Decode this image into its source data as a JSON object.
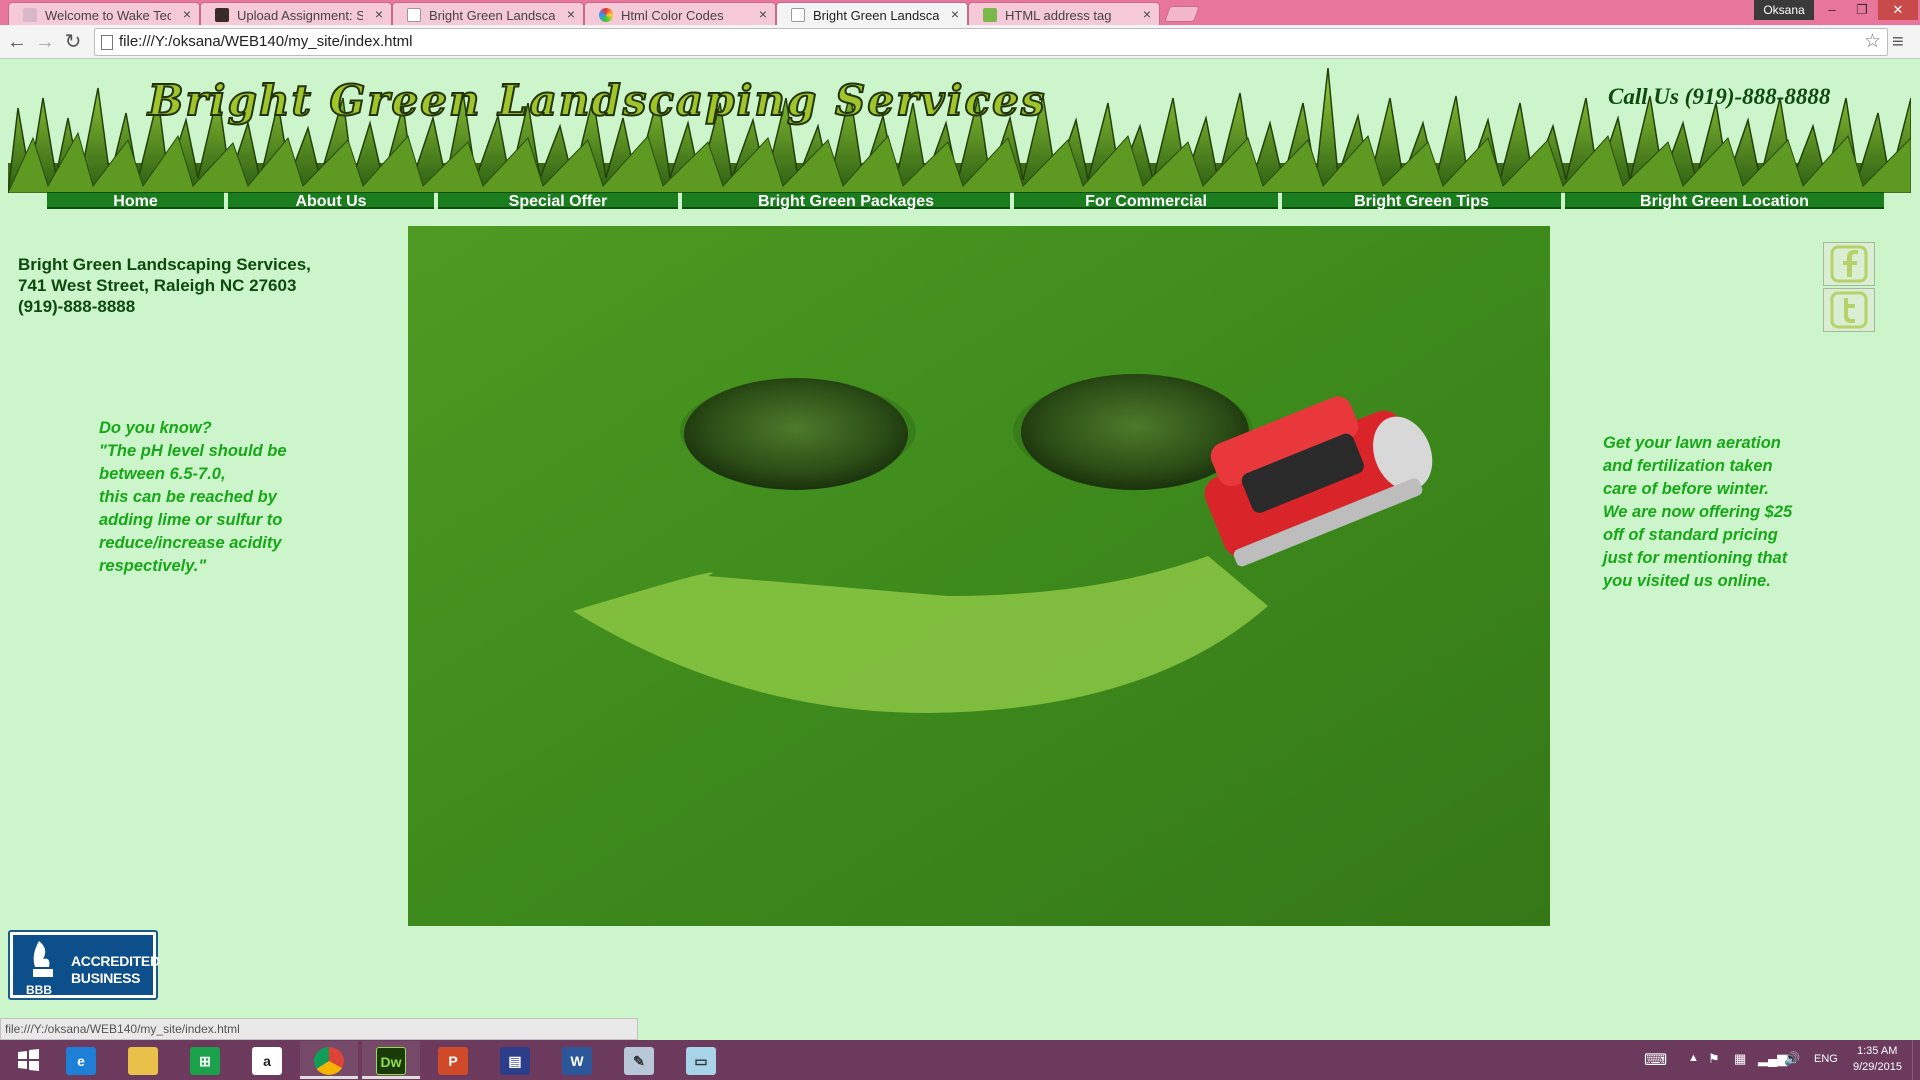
{
  "browser": {
    "tabs": [
      {
        "title": "Welcome to Wake Techni",
        "active": false
      },
      {
        "title": "Upload Assignment: Site F",
        "active": false
      },
      {
        "title": "Bright Green Landscaping",
        "active": false
      },
      {
        "title": "Html Color Codes",
        "active": false
      },
      {
        "title": "Bright Green Landscaping",
        "active": true
      },
      {
        "title": "HTML address tag",
        "active": false
      }
    ],
    "profile_name": "Oksana",
    "url": "file:///Y:/oksana/WEB140/my_site/index.html",
    "status_url": "file:///Y:/oksana/WEB140/my_site/index.html"
  },
  "site": {
    "title": "Bright Green Landscaping Services",
    "phone_header": "Call Us (919)-888-8888",
    "nav": [
      "Home",
      "About Us",
      "Special Offer",
      "Bright Green Packages",
      "For Commercial",
      "Bright Green Tips",
      "Bright Green Location"
    ],
    "address": {
      "line1": "Bright Green Landscaping Services,",
      "line2": "741 West Street, Raleigh NC 27603",
      "line3": "(919)-888-8888"
    },
    "tip_left": [
      "Do you know?",
      "\"The pH level should be",
      "between 6.5-7.0,",
      "this can be reached by",
      "adding lime or sulfur to",
      "reduce/increase acidity",
      "respectively.\""
    ],
    "tip_right": [
      "Get your lawn aeration",
      "and fertilization taken",
      "care of before winter.",
      "We are now offering $25",
      "off of standard pricing",
      "just for mentioning that",
      "you visited us online."
    ],
    "social": [
      "facebook-icon",
      "twitter-icon"
    ],
    "bbb": {
      "text1": "ACCREDITED",
      "text2": "BUSINESS",
      "label": "BBB"
    }
  },
  "taskbar": {
    "apps": [
      "start",
      "internet-explorer",
      "file-explorer",
      "store",
      "amazon",
      "chrome",
      "dreamweaver",
      "powerpoint",
      "save",
      "word",
      "paint",
      "notepad"
    ],
    "language": "ENG",
    "time": "1:35 AM",
    "date": "9/29/2015"
  }
}
